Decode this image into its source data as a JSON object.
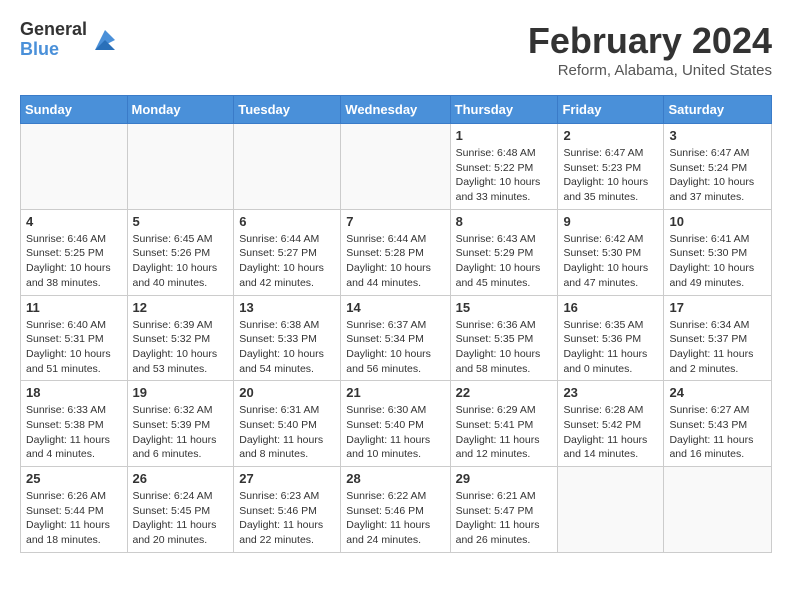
{
  "logo": {
    "general": "General",
    "blue": "Blue"
  },
  "title": "February 2024",
  "location": "Reform, Alabama, United States",
  "days_of_week": [
    "Sunday",
    "Monday",
    "Tuesday",
    "Wednesday",
    "Thursday",
    "Friday",
    "Saturday"
  ],
  "weeks": [
    [
      {
        "day": "",
        "info": ""
      },
      {
        "day": "",
        "info": ""
      },
      {
        "day": "",
        "info": ""
      },
      {
        "day": "",
        "info": ""
      },
      {
        "day": "1",
        "info": "Sunrise: 6:48 AM\nSunset: 5:22 PM\nDaylight: 10 hours\nand 33 minutes."
      },
      {
        "day": "2",
        "info": "Sunrise: 6:47 AM\nSunset: 5:23 PM\nDaylight: 10 hours\nand 35 minutes."
      },
      {
        "day": "3",
        "info": "Sunrise: 6:47 AM\nSunset: 5:24 PM\nDaylight: 10 hours\nand 37 minutes."
      }
    ],
    [
      {
        "day": "4",
        "info": "Sunrise: 6:46 AM\nSunset: 5:25 PM\nDaylight: 10 hours\nand 38 minutes."
      },
      {
        "day": "5",
        "info": "Sunrise: 6:45 AM\nSunset: 5:26 PM\nDaylight: 10 hours\nand 40 minutes."
      },
      {
        "day": "6",
        "info": "Sunrise: 6:44 AM\nSunset: 5:27 PM\nDaylight: 10 hours\nand 42 minutes."
      },
      {
        "day": "7",
        "info": "Sunrise: 6:44 AM\nSunset: 5:28 PM\nDaylight: 10 hours\nand 44 minutes."
      },
      {
        "day": "8",
        "info": "Sunrise: 6:43 AM\nSunset: 5:29 PM\nDaylight: 10 hours\nand 45 minutes."
      },
      {
        "day": "9",
        "info": "Sunrise: 6:42 AM\nSunset: 5:30 PM\nDaylight: 10 hours\nand 47 minutes."
      },
      {
        "day": "10",
        "info": "Sunrise: 6:41 AM\nSunset: 5:30 PM\nDaylight: 10 hours\nand 49 minutes."
      }
    ],
    [
      {
        "day": "11",
        "info": "Sunrise: 6:40 AM\nSunset: 5:31 PM\nDaylight: 10 hours\nand 51 minutes."
      },
      {
        "day": "12",
        "info": "Sunrise: 6:39 AM\nSunset: 5:32 PM\nDaylight: 10 hours\nand 53 minutes."
      },
      {
        "day": "13",
        "info": "Sunrise: 6:38 AM\nSunset: 5:33 PM\nDaylight: 10 hours\nand 54 minutes."
      },
      {
        "day": "14",
        "info": "Sunrise: 6:37 AM\nSunset: 5:34 PM\nDaylight: 10 hours\nand 56 minutes."
      },
      {
        "day": "15",
        "info": "Sunrise: 6:36 AM\nSunset: 5:35 PM\nDaylight: 10 hours\nand 58 minutes."
      },
      {
        "day": "16",
        "info": "Sunrise: 6:35 AM\nSunset: 5:36 PM\nDaylight: 11 hours\nand 0 minutes."
      },
      {
        "day": "17",
        "info": "Sunrise: 6:34 AM\nSunset: 5:37 PM\nDaylight: 11 hours\nand 2 minutes."
      }
    ],
    [
      {
        "day": "18",
        "info": "Sunrise: 6:33 AM\nSunset: 5:38 PM\nDaylight: 11 hours\nand 4 minutes."
      },
      {
        "day": "19",
        "info": "Sunrise: 6:32 AM\nSunset: 5:39 PM\nDaylight: 11 hours\nand 6 minutes."
      },
      {
        "day": "20",
        "info": "Sunrise: 6:31 AM\nSunset: 5:40 PM\nDaylight: 11 hours\nand 8 minutes."
      },
      {
        "day": "21",
        "info": "Sunrise: 6:30 AM\nSunset: 5:40 PM\nDaylight: 11 hours\nand 10 minutes."
      },
      {
        "day": "22",
        "info": "Sunrise: 6:29 AM\nSunset: 5:41 PM\nDaylight: 11 hours\nand 12 minutes."
      },
      {
        "day": "23",
        "info": "Sunrise: 6:28 AM\nSunset: 5:42 PM\nDaylight: 11 hours\nand 14 minutes."
      },
      {
        "day": "24",
        "info": "Sunrise: 6:27 AM\nSunset: 5:43 PM\nDaylight: 11 hours\nand 16 minutes."
      }
    ],
    [
      {
        "day": "25",
        "info": "Sunrise: 6:26 AM\nSunset: 5:44 PM\nDaylight: 11 hours\nand 18 minutes."
      },
      {
        "day": "26",
        "info": "Sunrise: 6:24 AM\nSunset: 5:45 PM\nDaylight: 11 hours\nand 20 minutes."
      },
      {
        "day": "27",
        "info": "Sunrise: 6:23 AM\nSunset: 5:46 PM\nDaylight: 11 hours\nand 22 minutes."
      },
      {
        "day": "28",
        "info": "Sunrise: 6:22 AM\nSunset: 5:46 PM\nDaylight: 11 hours\nand 24 minutes."
      },
      {
        "day": "29",
        "info": "Sunrise: 6:21 AM\nSunset: 5:47 PM\nDaylight: 11 hours\nand 26 minutes."
      },
      {
        "day": "",
        "info": ""
      },
      {
        "day": "",
        "info": ""
      }
    ]
  ]
}
